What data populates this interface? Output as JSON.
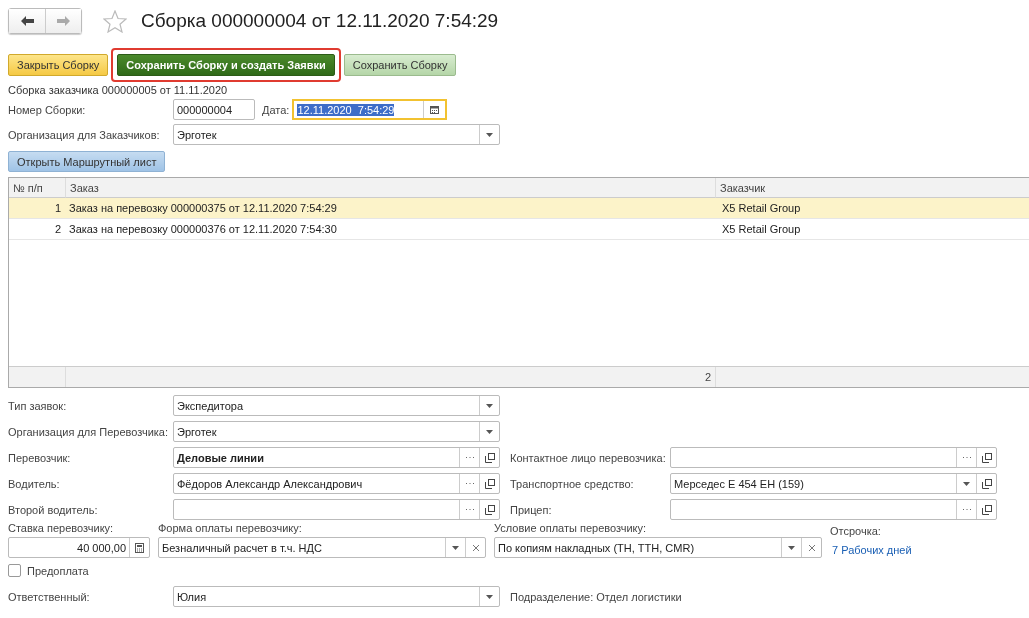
{
  "header": {
    "title": "Сборка 000000004 от 12.11.2020 7:54:29"
  },
  "toolbar": [
    {
      "label": "Закрыть Сборку",
      "kind": "close",
      "highlighted": false
    },
    {
      "label": "Сохранить Сборку и создать Заявки",
      "kind": "primary",
      "highlighted": true
    },
    {
      "label": "Сохранить Сборку",
      "kind": "save",
      "highlighted": false
    }
  ],
  "customer_assembly": "Сборка заказчика 000000005 от 11.11.2020",
  "number": {
    "label": "Номер Сборки:",
    "value": "000000004"
  },
  "date": {
    "label": "Дата:",
    "value": "12.11.2020  7:54:29",
    "focused": true
  },
  "customer_org": {
    "label": "Организация для Заказчиков:",
    "value": "Эрготек"
  },
  "route_button": "Открыть Маршрутный лист",
  "table": {
    "columns": [
      "№ п/п",
      "Заказ",
      "Заказчик"
    ],
    "rows": [
      {
        "n": "1",
        "order": "Заказ на перевозку 000000375 от 12.11.2020 7:54:29",
        "customer": "X5 Retail Group",
        "selected": true
      },
      {
        "n": "2",
        "order": "Заказ на перевозку 000000376 от 12.11.2020 7:54:30",
        "customer": "X5 Retail Group",
        "selected": false
      }
    ],
    "footer_count": "2"
  },
  "form_rows": [
    {
      "left": {
        "label": "Тип заявок:",
        "value": "Экспедитора",
        "kind": "select",
        "bold": false
      }
    },
    {
      "left": {
        "label": "Организация для Перевозчика:",
        "value": "Эрготек",
        "kind": "select",
        "bold": false
      }
    },
    {
      "left": {
        "label": "Перевозчик:",
        "value": "Деловые линии",
        "kind": "ref",
        "bold": true
      },
      "right": {
        "label": "Контактное лицо перевозчика:",
        "kind": "ref"
      }
    },
    {
      "left": {
        "label": "Водитель:",
        "value": "Фёдоров Александр Александрович",
        "kind": "ref",
        "bold": false
      },
      "right": {
        "label": "Транспортное средство:",
        "value": "Мерседес Е 454 ЕН (159)",
        "kind": "select_open",
        "bold": false
      }
    },
    {
      "left": {
        "label": "Второй водитель:",
        "kind": "ref"
      },
      "right": {
        "label": "Прицеп:",
        "kind": "ref"
      }
    }
  ],
  "payment": {
    "rate": {
      "label": "Ставка перевозчику:",
      "value": "40 000,00"
    },
    "form": {
      "label": "Форма оплаты перевозчику:",
      "value": "Безналичный расчет в т.ч. НДС"
    },
    "condition": {
      "label": "Условие оплаты перевозчику:",
      "value": "По копиям накладных (ТН, ТТН, CMR)"
    },
    "deferral": {
      "label": "Отсрочка:",
      "link": "7 Рабочих дней"
    }
  },
  "prepayment": {
    "label": "Предоплата",
    "checked": false
  },
  "responsible": {
    "label": "Ответственный:",
    "value": "Юлия"
  },
  "department": "Подразделение: Отдел логистики"
}
